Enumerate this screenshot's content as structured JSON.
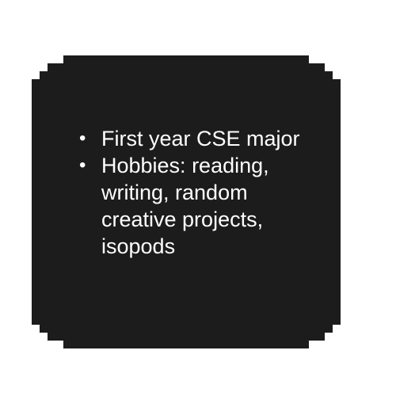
{
  "card": {
    "background_color": "#1c1c1c",
    "text_color": "#ffffff",
    "bullet_glyph": "•",
    "items": [
      {
        "text": "First year CSE major"
      },
      {
        "text": "Hobbies: reading, writing, random creative projects, isopods"
      }
    ]
  }
}
